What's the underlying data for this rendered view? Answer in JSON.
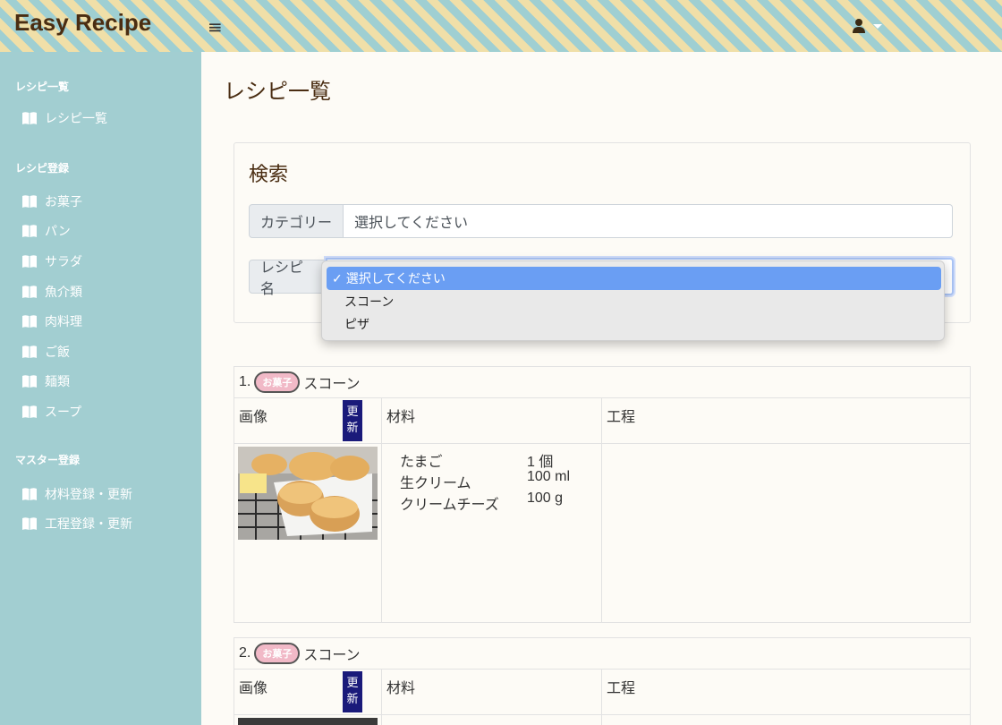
{
  "app": {
    "brand": "Easy Recipe",
    "menu_icon": "hamburger-icon",
    "user_icon": "user-icon"
  },
  "sidebar": {
    "sections": [
      {
        "heading": "レシピ一覧",
        "items": [
          "レシピ一覧"
        ]
      },
      {
        "heading": "レシピ登録",
        "items": [
          "お菓子",
          "パン",
          "サラダ",
          "魚介類",
          "肉料理",
          "ご飯",
          "麺類",
          "スープ"
        ]
      },
      {
        "heading": "マスター登録",
        "items": [
          "材料登録・更新",
          "工程登録・更新"
        ]
      }
    ],
    "item_icon": "book-icon"
  },
  "main": {
    "title": "レシピ一覧"
  },
  "search": {
    "title": "検索",
    "category_label": "カテゴリー",
    "category_value": "選択してください",
    "recipe_label": "レシピ名",
    "recipe_value": "選択してください",
    "options": [
      "選択してください",
      "スコーン",
      "ピザ"
    ],
    "selected_index": 0,
    "check": "✓"
  },
  "table_headers": {
    "image": "画像",
    "update": "更新",
    "ingredients": "材料",
    "steps": "工程"
  },
  "recipes": [
    {
      "num": "1.",
      "category": "お菓子",
      "name": "スコーン",
      "ingredients": [
        {
          "name": "たまご",
          "qty": "1 個"
        },
        {
          "name": "生クリーム",
          "qty": "100 ml"
        },
        {
          "name": "クリームチーズ",
          "qty": "100 g"
        }
      ]
    },
    {
      "num": "2.",
      "category": "お菓子",
      "name": "スコーン"
    }
  ],
  "colors": {
    "sidebar": "#a2ced1",
    "badge": "#f1b9c7",
    "update_button": "#1a1a7a",
    "dropdown_selected": "#6a9ef3"
  }
}
